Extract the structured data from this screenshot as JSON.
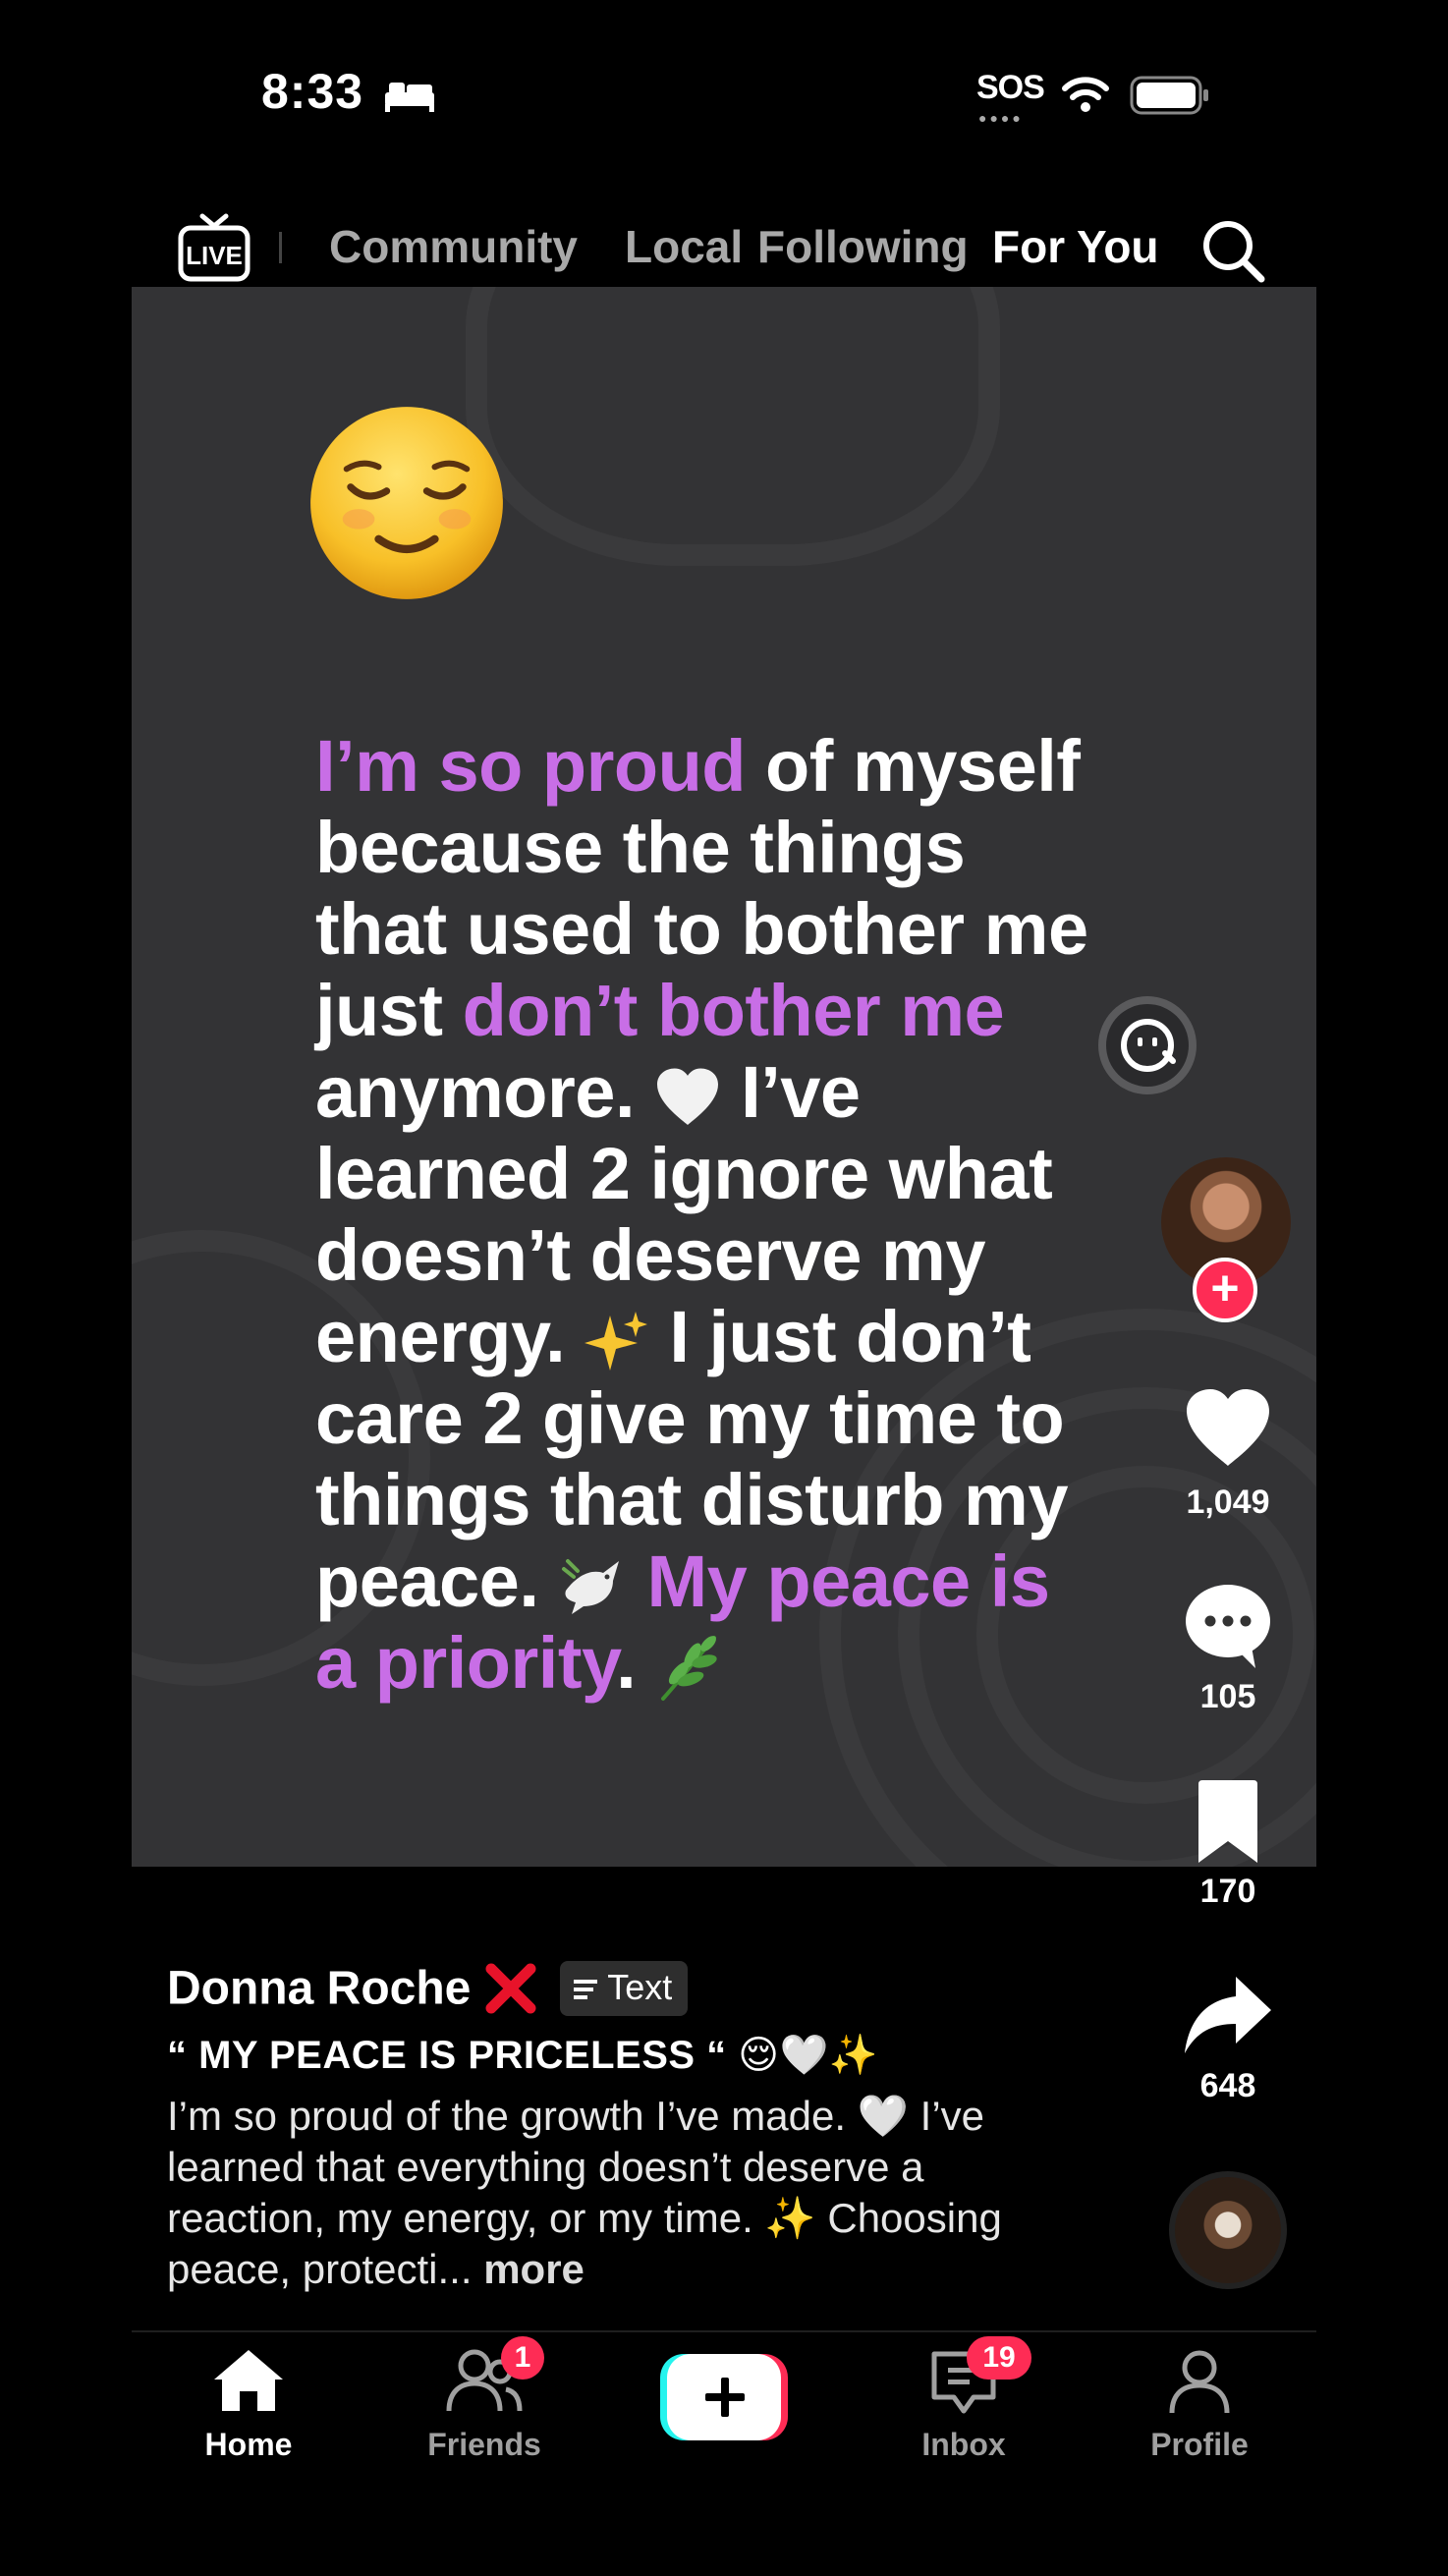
{
  "status_bar": {
    "time": "8:33",
    "sos": "SOS"
  },
  "top_nav": {
    "tabs": [
      {
        "label": "Community",
        "active": false
      },
      {
        "label": "Local",
        "active": false
      },
      {
        "label": "Following",
        "active": false
      },
      {
        "label": "For You",
        "active": true
      }
    ],
    "live_label": "LIVE"
  },
  "post": {
    "quote_segments": [
      {
        "text": "I’m so proud",
        "highlight": true
      },
      {
        "text": " of myself because the things that used to bother me just ",
        "highlight": false
      },
      {
        "text": "don’t bother me",
        "highlight": true
      },
      {
        "text": " anymore. 🤍 I’ve learned 2 ignore what doesn’t deserve my energy. ✨ I just don’t care 2 give my time to things that disturb my peace. 🕊️ ",
        "highlight": false
      },
      {
        "text": "My peace is a priority",
        "highlight": true
      },
      {
        "text": ". 🌿",
        "highlight": false
      }
    ],
    "quote_lines": [
      [
        {
          "t": "I’m so proud",
          "h": true
        },
        {
          "t": " of myself",
          "h": false
        }
      ],
      [
        {
          "t": "because the things",
          "h": false
        }
      ],
      [
        {
          "t": "that used to bother me",
          "h": false
        }
      ],
      [
        {
          "t": "just ",
          "h": false
        },
        {
          "t": "don’t bother me",
          "h": true
        }
      ],
      [
        {
          "t": "anymore. ",
          "h": false
        },
        {
          "i": "white-heart"
        },
        {
          "t": " I’ve",
          "h": false
        }
      ],
      [
        {
          "t": "learned 2 ignore what",
          "h": false
        }
      ],
      [
        {
          "t": "doesn’t deserve my",
          "h": false
        }
      ],
      [
        {
          "t": "energy. ",
          "h": false
        },
        {
          "i": "sparkles"
        },
        {
          "t": " I just don’t",
          "h": false
        }
      ],
      [
        {
          "t": "care 2 give my time to",
          "h": false
        }
      ],
      [
        {
          "t": "things that disturb my",
          "h": false
        }
      ],
      [
        {
          "t": "peace. ",
          "h": false
        },
        {
          "i": "dove"
        },
        {
          "t": " ",
          "h": false
        },
        {
          "t": "My peace is",
          "h": true
        }
      ],
      [
        {
          "t": "a priority",
          "h": true
        },
        {
          "t": ". ",
          "h": false
        },
        {
          "i": "herb"
        }
      ]
    ],
    "highlight_color": "#c86ee6",
    "likes": "1,049",
    "comments": "105",
    "saves": "170",
    "shares": "648"
  },
  "caption": {
    "author": "Donna Roche",
    "author_mark": "red-x-icon",
    "badge_label": "Text",
    "title": "“ MY PEACE IS PRICELESS “ 😌🤍✨",
    "body": "I’m so proud of the growth I’ve made. 🤍 I’ve learned that everything doesn’t deserve a reaction, my energy, or my time. ✨ Choosing peace, protecti...",
    "more": "more"
  },
  "bottom_nav": {
    "home": "Home",
    "friends": "Friends",
    "friends_badge": "1",
    "inbox": "Inbox",
    "inbox_badge": "19",
    "profile": "Profile"
  },
  "colors": {
    "accent": "#fe2c55",
    "cyan": "#25f4ee",
    "video_bg": "#333335"
  }
}
